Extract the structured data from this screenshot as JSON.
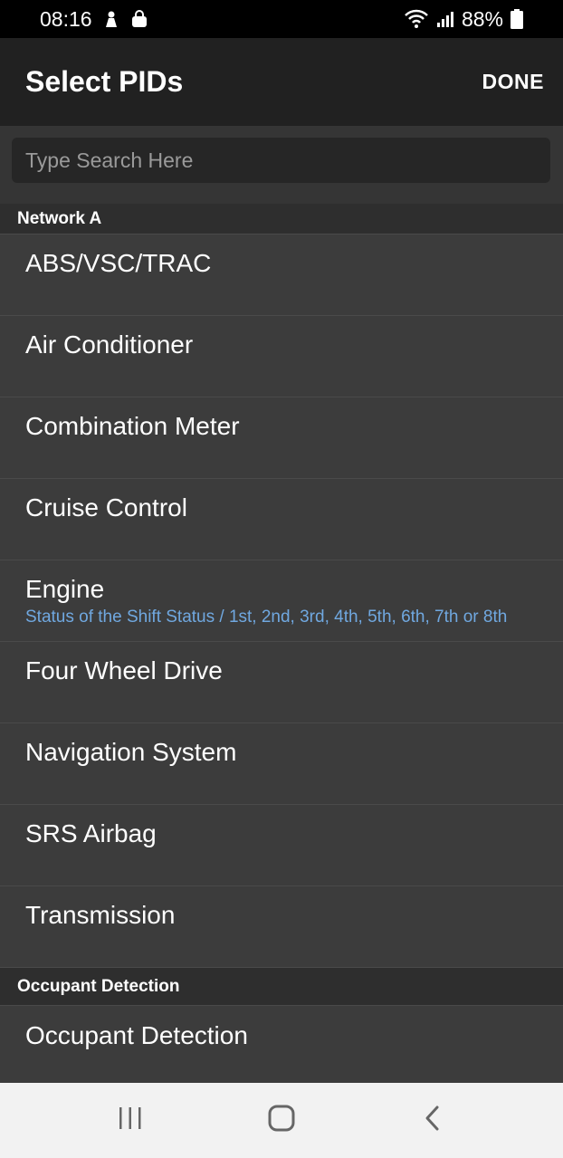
{
  "status_bar": {
    "time": "08:16",
    "battery_percent": "88%",
    "icons": [
      "notification-icon",
      "shopping-bag-icon",
      "wifi-icon",
      "signal-icon",
      "battery-icon"
    ]
  },
  "app_bar": {
    "title": "Select PIDs",
    "done_label": "DONE"
  },
  "search": {
    "placeholder": "Type Search Here",
    "value": ""
  },
  "sections": [
    {
      "header": "Network A",
      "items": [
        {
          "label": "ABS/VSC/TRAC",
          "subtitle": ""
        },
        {
          "label": "Air Conditioner",
          "subtitle": ""
        },
        {
          "label": "Combination Meter",
          "subtitle": ""
        },
        {
          "label": "Cruise Control",
          "subtitle": ""
        },
        {
          "label": "Engine",
          "subtitle": "Status of the Shift Status / 1st, 2nd, 3rd, 4th, 5th, 6th, 7th or 8th"
        },
        {
          "label": "Four Wheel Drive",
          "subtitle": ""
        },
        {
          "label": "Navigation System",
          "subtitle": ""
        },
        {
          "label": "SRS Airbag",
          "subtitle": ""
        },
        {
          "label": "Transmission",
          "subtitle": ""
        }
      ]
    },
    {
      "header": "Occupant Detection",
      "items": [
        {
          "label": "Occupant Detection",
          "subtitle": ""
        }
      ]
    }
  ],
  "nav_bar": {
    "buttons": [
      "recent-apps-icon",
      "home-icon",
      "back-icon"
    ]
  },
  "colors": {
    "subtitle_accent": "#70a8e0",
    "app_bar_bg": "#212121",
    "list_bg": "#3c3c3c"
  }
}
